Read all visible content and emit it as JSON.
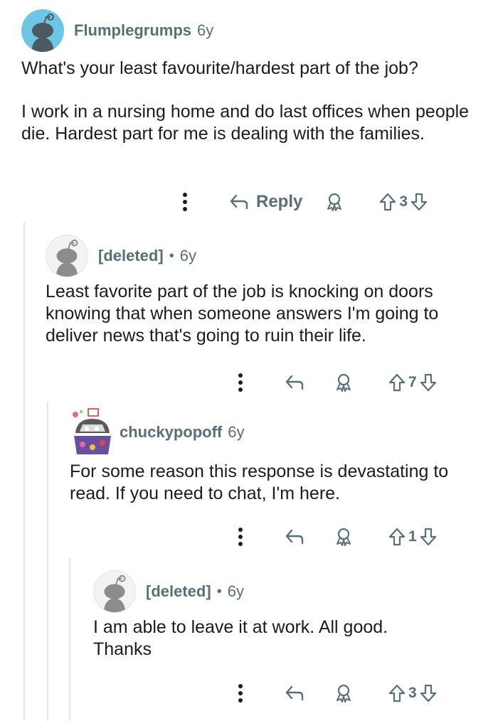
{
  "comments": [
    {
      "username": "Flumplegrumps",
      "age": "6y",
      "paragraphs": [
        "What's your least favourite/hardest part of the job?",
        "I work in a nursing home and do last offices when people die. Hardest part for me is dealing with the families."
      ],
      "reply_label": "Reply",
      "votes": "3"
    },
    {
      "username": "[deleted]",
      "separator": "•",
      "age": "6y",
      "text": "Least favorite part of the job is knocking on doors knowing that when someone answers I'm going to deliver news that's going to ruin their life.",
      "votes": "7"
    },
    {
      "username": "chuckypopoff",
      "age": "6y",
      "text": "For some reason this response is devastating to read. If you need to chat, I'm here.",
      "votes": "1"
    },
    {
      "username": "[deleted]",
      "separator": "•",
      "age": "6y",
      "text": "I am able to leave it at work. All good. Thanks",
      "votes": "3"
    }
  ],
  "icons": {
    "more": "more-vertical-icon",
    "reply": "reply-arrow-icon",
    "award": "award-icon",
    "upvote": "upvote-arrow-icon",
    "downvote": "downvote-arrow-icon"
  },
  "colors": {
    "meta_text": "#576f76",
    "thread_line": "#e4e6e8",
    "avatar_blue": "#6ec6e6"
  }
}
